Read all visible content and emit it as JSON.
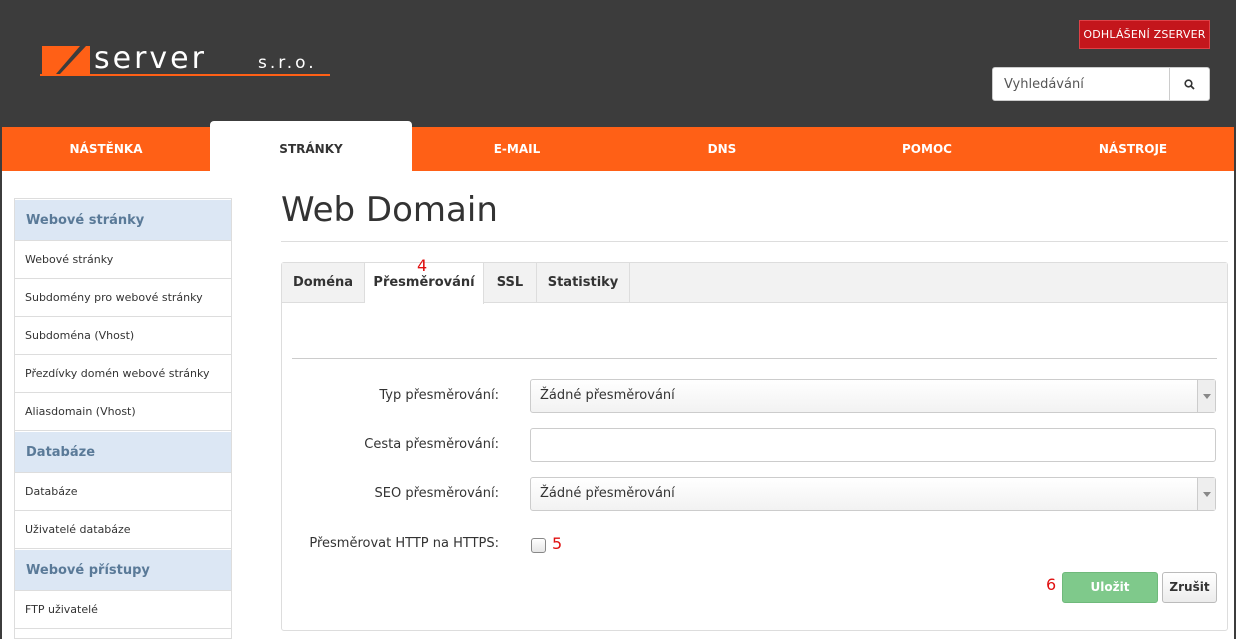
{
  "brand": {
    "logo_text": "server",
    "logo_suffix": "s.r.o."
  },
  "header": {
    "logout_label": "ODHLÁŠENÍ ZSERVER",
    "search_placeholder": "Vyhledávání"
  },
  "nav": [
    "NÁSTĚNKA",
    "STRÁNKY",
    "E-MAIL",
    "DNS",
    "POMOC",
    "NÁSTROJE"
  ],
  "sidebar": {
    "groups": [
      {
        "title": "Webové stránky",
        "items": [
          "Webové stránky",
          "Subdomény pro webové stránky",
          "Subdoména (Vhost)",
          "Přezdívky domén webové stránky",
          "Aliasdomain (Vhost)"
        ]
      },
      {
        "title": "Databáze",
        "items": [
          "Databáze",
          "Uživatelé databáze"
        ]
      },
      {
        "title": "Webové přístupy",
        "items": [
          "FTP uživatelé"
        ]
      }
    ]
  },
  "page": {
    "title": "Web Domain"
  },
  "tabs": [
    "Doména",
    "Přesměrování",
    "SSL",
    "Statistiky"
  ],
  "form": {
    "redirect_type_label": "Typ přesměrování:",
    "redirect_type_value": "Žádné přesměrování",
    "redirect_path_label": "Cesta přesměrování:",
    "redirect_path_value": "",
    "seo_label": "SEO přesměrování:",
    "seo_value": "Žádné přesměrování",
    "https_label": "Přesměrovat HTTP na HTTPS:",
    "https_checked": false
  },
  "actions": {
    "save_label": "Uložit",
    "cancel_label": "Zrušit"
  },
  "annotations": {
    "tab_marker": "4",
    "checkbox_marker": "5",
    "save_marker": "6"
  },
  "colors": {
    "header_bg": "#3c3c3c",
    "nav_bg": "#ff6016",
    "logout_bg": "#c4161c",
    "save_bg": "#7fc98b",
    "sidebar_head_bg": "#dce7f4"
  }
}
